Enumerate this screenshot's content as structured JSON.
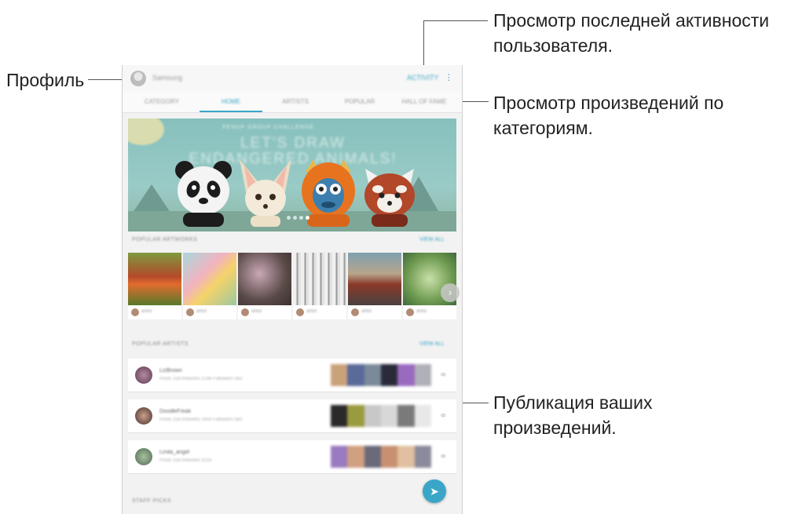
{
  "callouts": {
    "profile": "Профиль",
    "activity_line1": "Просмотр последней активности",
    "activity_line2": "пользователя.",
    "categories_line1": "Просмотр произведений по",
    "categories_line2": "категориям.",
    "publish_line1": "Публикация ваших",
    "publish_line2": "произведений."
  },
  "header": {
    "user_name": "Samsung",
    "activity_label": "ACTIVITY",
    "more_icon": "more-vert-icon"
  },
  "tabs": [
    {
      "label": "CATEGORY",
      "active": false
    },
    {
      "label": "HOME",
      "active": true
    },
    {
      "label": "ARTISTS",
      "active": false
    },
    {
      "label": "POPULAR",
      "active": false
    },
    {
      "label": "HALL OF FAME",
      "active": false
    }
  ],
  "banner": {
    "subtitle": "PENUP GROUP CHALLENGE",
    "title_line1": "LET'S DRAW",
    "title_line2": "ENDANGERED ANIMALS!"
  },
  "popular_artworks": {
    "title": "POPULAR ARTWORKS",
    "view_all": "VIEW ALL",
    "items": [
      {
        "name": "artist",
        "color": "#7a9a3c"
      },
      {
        "name": "artist",
        "color": "#9fd0d3"
      },
      {
        "name": "artist",
        "color": "#5a4a48"
      },
      {
        "name": "artist",
        "color": "#e8e8e8"
      },
      {
        "name": "artist",
        "color": "#7a4a3a"
      },
      {
        "name": "artist",
        "color": "#7ea060"
      }
    ]
  },
  "popular_artists": {
    "title": "POPULAR ARTISTS",
    "view_all": "VIEW ALL",
    "rows": [
      {
        "name": "LizBrown",
        "sub": "Posts 158 Artworks 2149 Followers 563"
      },
      {
        "name": "DoodleFreak",
        "sub": "Posts 158 Artworks 1454 Followers 563"
      },
      {
        "name": "Linda_angel",
        "sub": "Posts 158 Artworks 3119"
      }
    ]
  },
  "staff_picks": {
    "title": "STAFF PICKS"
  },
  "colors": {
    "accent": "#3aa6c7"
  }
}
